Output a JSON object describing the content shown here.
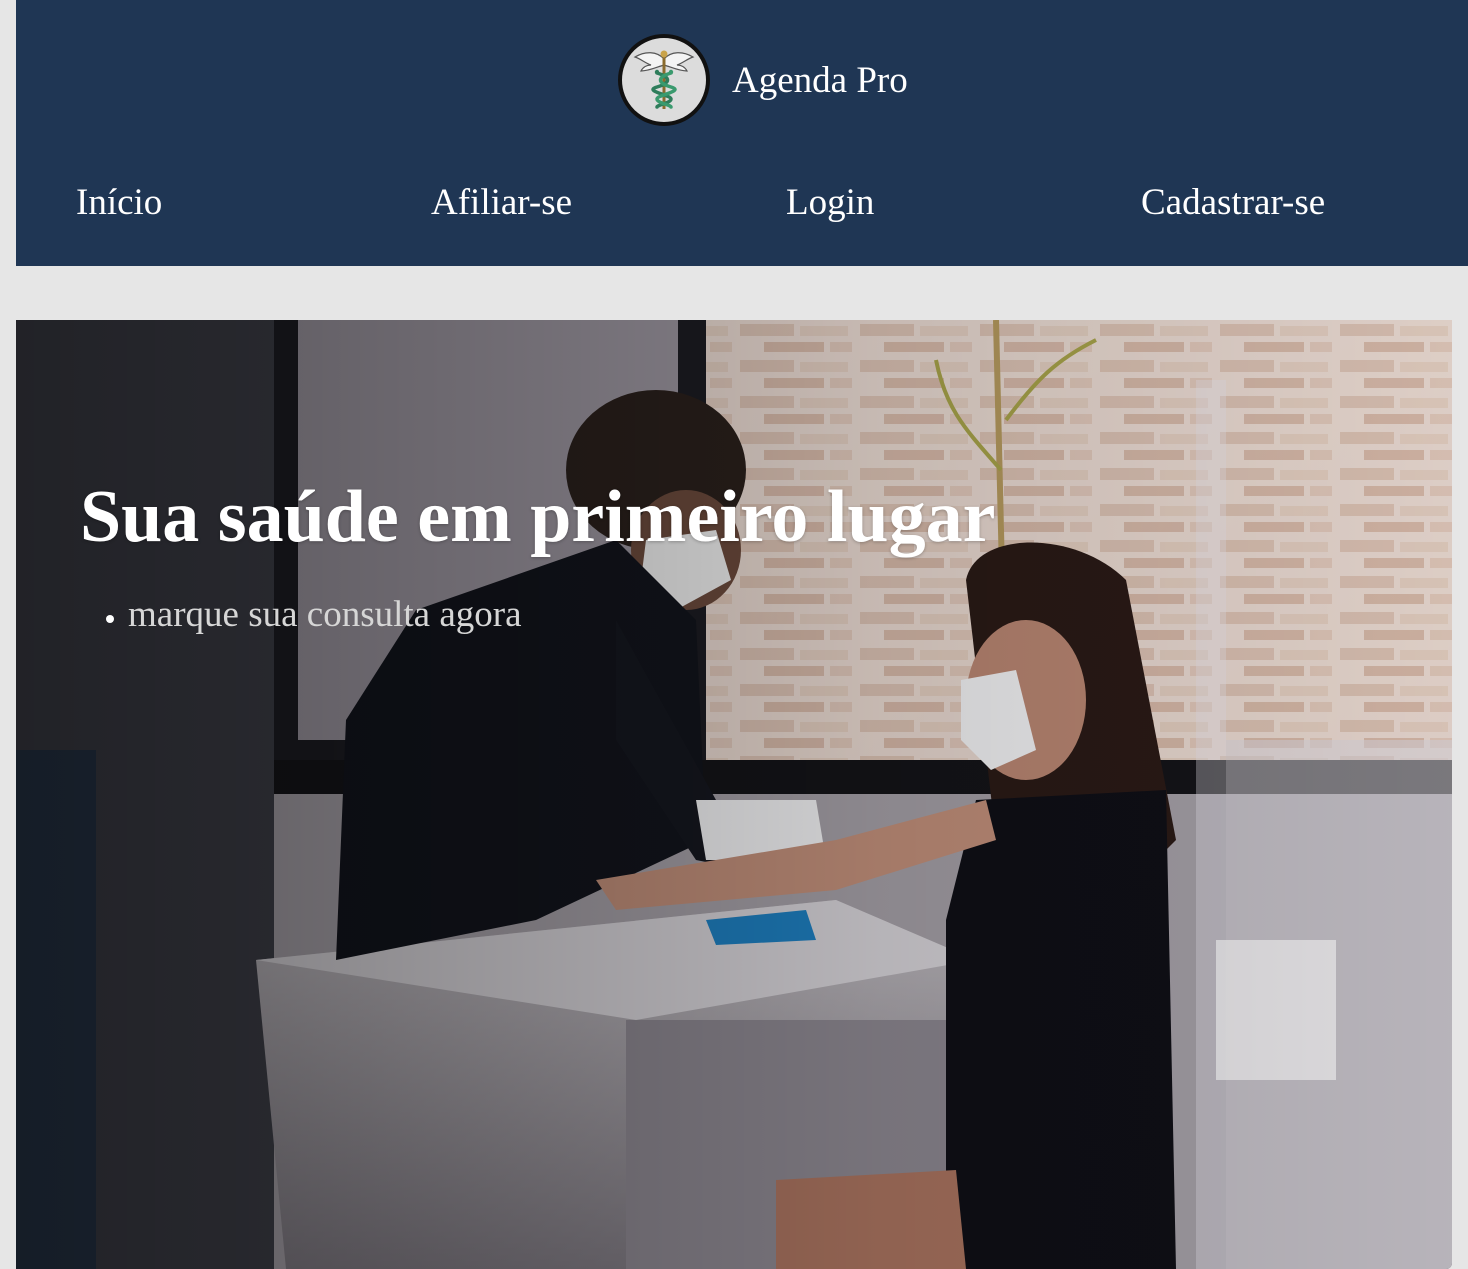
{
  "header": {
    "brand_name": "Agenda Pro",
    "logo_icon": "caduceus-icon",
    "background_color": "#1f3654"
  },
  "nav": {
    "items": [
      {
        "label": "Início"
      },
      {
        "label": "Afiliar-se"
      },
      {
        "label": "Login"
      },
      {
        "label": "Cadastrar-se"
      }
    ]
  },
  "hero": {
    "title": "Sua saúde em primeiro lugar",
    "bullets": [
      "marque sua consulta agora"
    ],
    "image": "clinic-blood-draw-photo"
  }
}
